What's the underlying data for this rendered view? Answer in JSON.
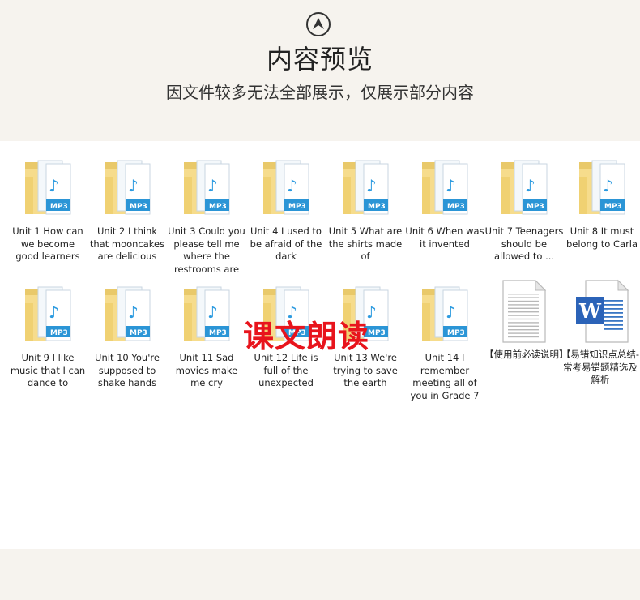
{
  "header": {
    "title": "内容预览",
    "subtitle": "因文件较多无法全部展示，仅展示部分内容"
  },
  "files": [
    {
      "label": "Unit 1 How can we become good learners",
      "type": "folder"
    },
    {
      "label": "Unit 2 I think that mooncakes are delicious",
      "type": "folder"
    },
    {
      "label": "Unit 3 Could you please tell me where the restrooms are",
      "type": "folder"
    },
    {
      "label": "Unit 4 I used to be afraid of the dark",
      "type": "folder"
    },
    {
      "label": "Unit 5 What are the shirts made of",
      "type": "folder"
    },
    {
      "label": "Unit 6 When was it invented",
      "type": "folder"
    },
    {
      "label": "Unit 7 Teenagers should be allowed to ...",
      "type": "folder"
    },
    {
      "label": "Unit 8 It  must belong to Carla",
      "type": "folder"
    },
    {
      "label": "Unit 9 I like music that I can dance to",
      "type": "folder"
    },
    {
      "label": "Unit 10 You're supposed to shake hands",
      "type": "folder"
    },
    {
      "label": "Unit 11 Sad movies make me cry",
      "type": "folder"
    },
    {
      "label": "Unit 12 Life is full of the unexpected",
      "type": "folder"
    },
    {
      "label": "Unit 13 We're trying to save the earth",
      "type": "folder"
    },
    {
      "label": "Unit 14 I remember meeting all of you in Grade 7",
      "type": "folder"
    },
    {
      "label": "【使用前必读说明】",
      "type": "text-file"
    },
    {
      "label": "【易错知识点总结-常考易错题精选及解析",
      "type": "word-file"
    }
  ],
  "watermark": "课文朗读",
  "icons": {
    "up": "chevron-up-circle-icon",
    "folder": "mp3-folder-icon",
    "text": "text-document-icon",
    "word": "word-document-icon"
  },
  "colors": {
    "watermark": "#e8141c",
    "background": "#f6f3ee",
    "panel": "#ffffff"
  }
}
